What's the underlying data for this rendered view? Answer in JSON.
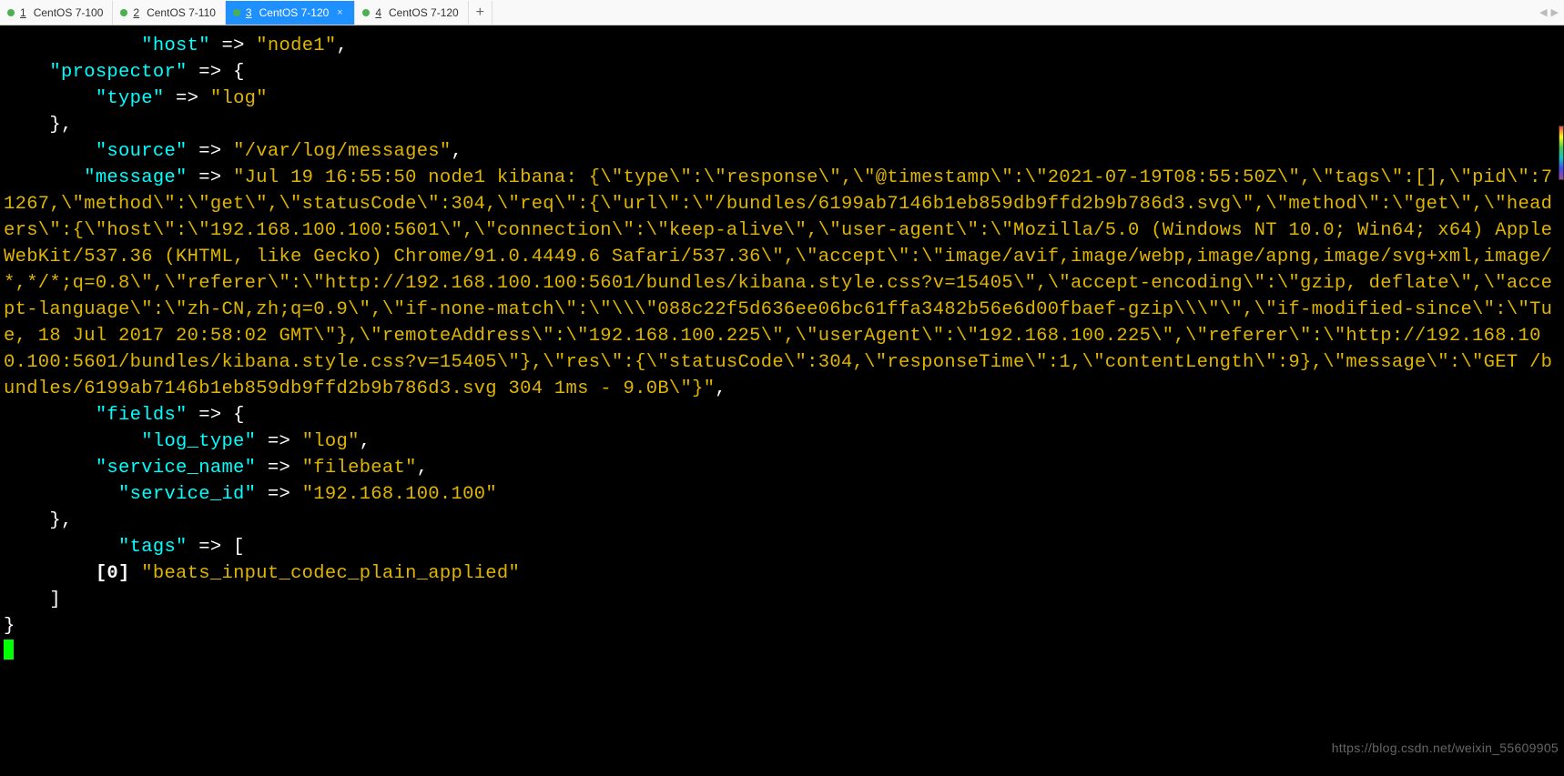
{
  "tabs": [
    {
      "num": "1",
      "label": "CentOS 7-100",
      "active": false
    },
    {
      "num": "2",
      "label": "CentOS 7-110",
      "active": false
    },
    {
      "num": "3",
      "label": "CentOS 7-120",
      "active": true
    },
    {
      "num": "4",
      "label": "CentOS 7-120",
      "active": false
    }
  ],
  "nav": {
    "left": "◀",
    "right": "▶"
  },
  "add": "+",
  "watermark": "https://blog.csdn.net/weixin_55609905",
  "term": {
    "host_k": "\"host\"",
    "arrow": " => ",
    "host_v": "\"node1\"",
    "comma": ",",
    "prospector_k": "\"prospector\"",
    "brace_open": "{",
    "type_k": "\"type\"",
    "type_v": "\"log\"",
    "brace_close_c": "},",
    "source_k": "\"source\"",
    "source_v": "\"/var/log/messages\"",
    "message_k": "\"message\"",
    "message_v": "\"Jul 19 16:55:50 node1 kibana: {\\\"type\\\":\\\"response\\\",\\\"@timestamp\\\":\\\"2021-07-19T08:55:50Z\\\",\\\"tags\\\":[],\\\"pid\\\":71267,\\\"method\\\":\\\"get\\\",\\\"statusCode\\\":304,\\\"req\\\":{\\\"url\\\":\\\"/bundles/6199ab7146b1eb859db9ffd2b9b786d3.svg\\\",\\\"method\\\":\\\"get\\\",\\\"headers\\\":{\\\"host\\\":\\\"192.168.100.100:5601\\\",\\\"connection\\\":\\\"keep-alive\\\",\\\"user-agent\\\":\\\"Mozilla/5.0 (Windows NT 10.0; Win64; x64) AppleWebKit/537.36 (KHTML, like Gecko) Chrome/91.0.4449.6 Safari/537.36\\\",\\\"accept\\\":\\\"image/avif,image/webp,image/apng,image/svg+xml,image/*,*/*;q=0.8\\\",\\\"referer\\\":\\\"http://192.168.100.100:5601/bundles/kibana.style.css?v=15405\\\",\\\"accept-encoding\\\":\\\"gzip, deflate\\\",\\\"accept-language\\\":\\\"zh-CN,zh;q=0.9\\\",\\\"if-none-match\\\":\\\"\\\\\\\"088c22f5d636ee06bc61ffa3482b56e6d00fbaef-gzip\\\\\\\"\\\",\\\"if-modified-since\\\":\\\"Tue, 18 Jul 2017 20:58:02 GMT\\\"},\\\"remoteAddress\\\":\\\"192.168.100.225\\\",\\\"userAgent\\\":\\\"192.168.100.225\\\",\\\"referer\\\":\\\"http://192.168.100.100:5601/bundles/kibana.style.css?v=15405\\\"},\\\"res\\\":{\\\"statusCode\\\":304,\\\"responseTime\\\":1,\\\"contentLength\\\":9},\\\"message\\\":\\\"GET /bundles/6199ab7146b1eb859db9ffd2b9b786d3.svg 304 1ms - 9.0B\\\"}\"",
    "fields_k": "\"fields\"",
    "log_type_k": "\"log_type\"",
    "log_type_v": "\"log\"",
    "service_name_k": "\"service_name\"",
    "service_name_v": "\"filebeat\"",
    "service_id_k": "\"service_id\"",
    "service_id_v": "\"192.168.100.100\"",
    "tags_k": "\"tags\"",
    "bracket_open": "[",
    "idx0": "[0] ",
    "tag0_v": "\"beats_input_codec_plain_applied\"",
    "bracket_close": "]",
    "final_brace": "}"
  }
}
